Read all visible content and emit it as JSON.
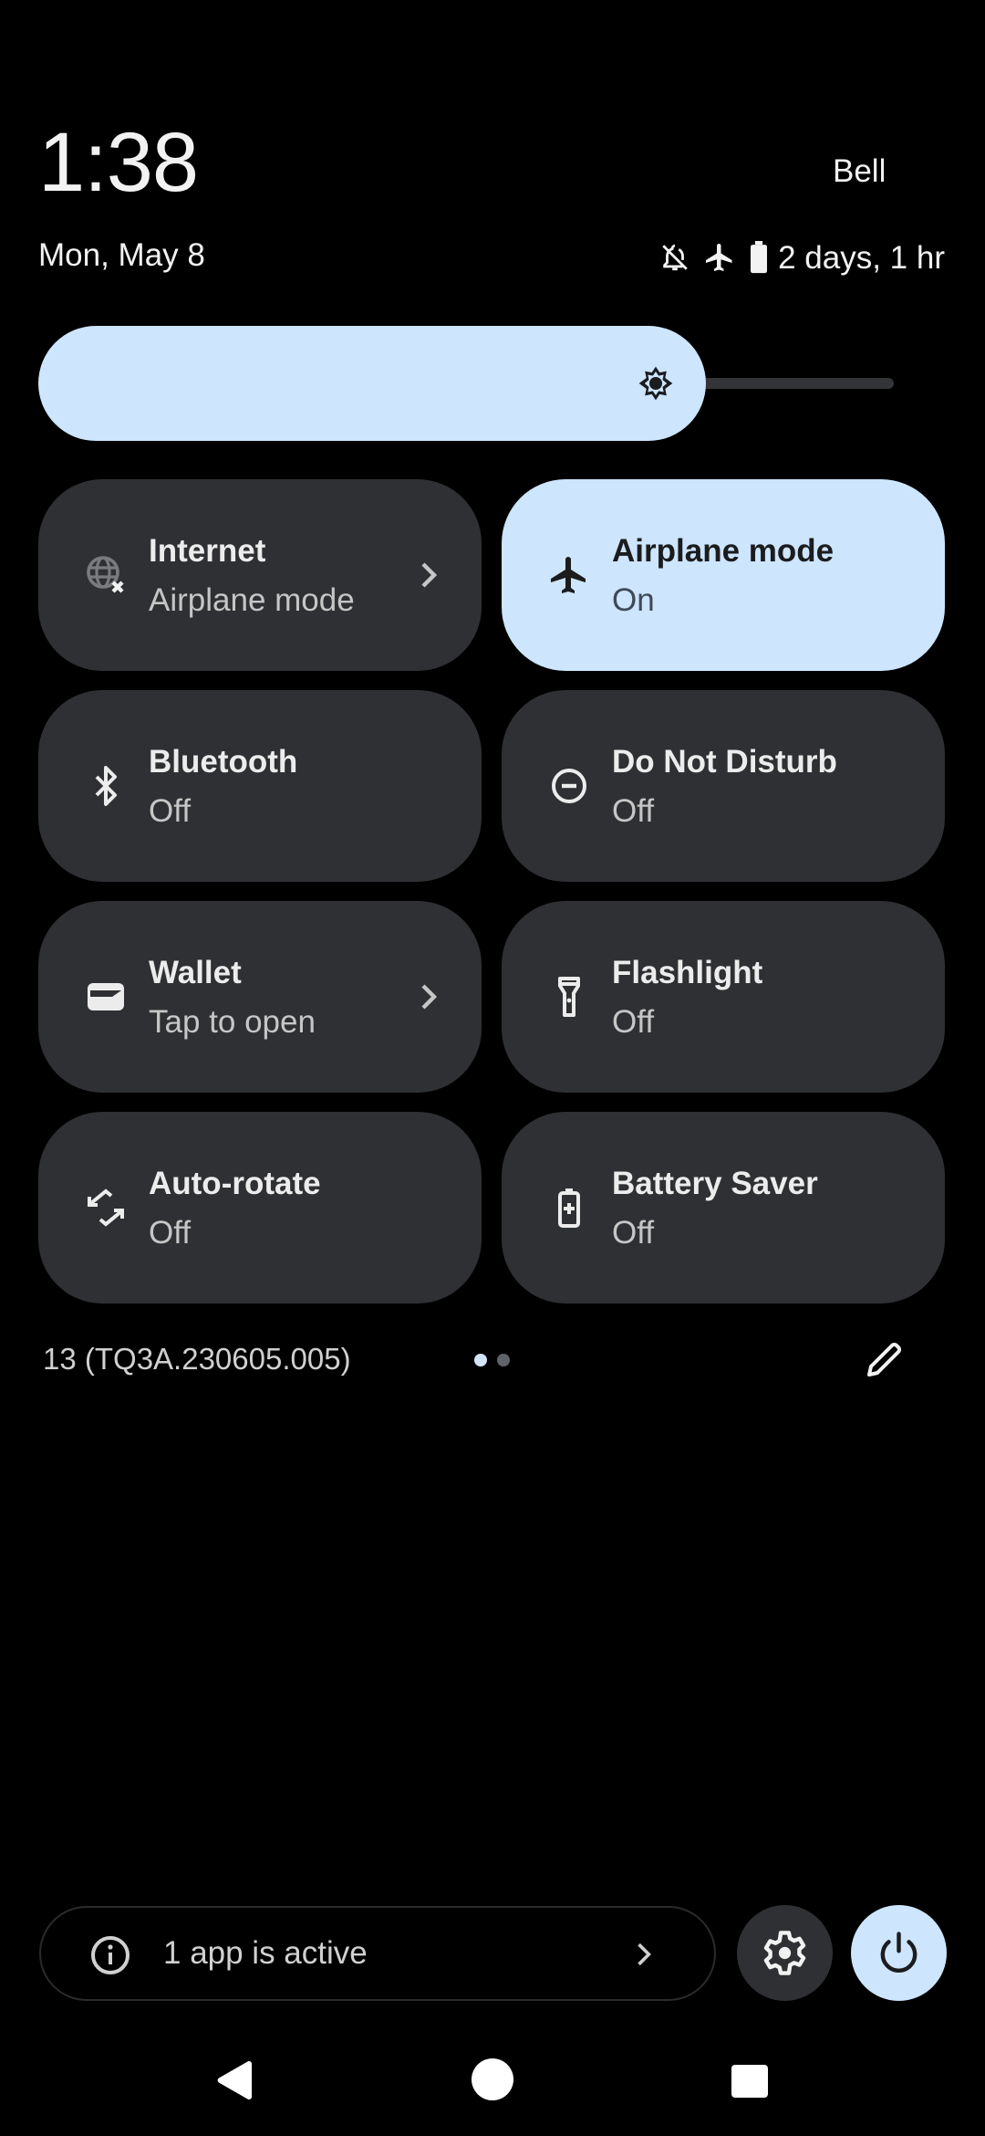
{
  "header": {
    "time": "1:38",
    "carrier": "Bell",
    "date": "Mon, May 8",
    "status_icons": [
      "dnd-off-bell-icon",
      "airplane-icon",
      "battery-icon"
    ],
    "battery_text": "2 days, 1 hr"
  },
  "brightness": {
    "icon": "brightness-icon",
    "level": 0.78
  },
  "tiles": [
    {
      "label": "Internet",
      "sub": "Airplane mode",
      "icon": "globe-off-icon",
      "state": "off",
      "has_chevron": true
    },
    {
      "label": "Airplane mode",
      "sub": "On",
      "icon": "airplane-icon",
      "state": "on",
      "has_chevron": false
    },
    {
      "label": "Bluetooth",
      "sub": "Off",
      "icon": "bluetooth-icon",
      "state": "off",
      "has_chevron": false
    },
    {
      "label": "Do Not Disturb",
      "sub": "Off",
      "icon": "do-not-disturb-icon",
      "state": "off",
      "has_chevron": false
    },
    {
      "label": "Wallet",
      "sub": "Tap to open",
      "icon": "wallet-icon",
      "state": "off",
      "has_chevron": true
    },
    {
      "label": "Flashlight",
      "sub": "Off",
      "icon": "flashlight-icon",
      "state": "off",
      "has_chevron": false
    },
    {
      "label": "Auto-rotate",
      "sub": "Off",
      "icon": "auto-rotate-icon",
      "state": "off",
      "has_chevron": false
    },
    {
      "label": "Battery Saver",
      "sub": "Off",
      "icon": "battery-saver-icon",
      "state": "off",
      "has_chevron": false
    }
  ],
  "build_number": "13 (TQ3A.230605.005)",
  "pager": {
    "pages": 2,
    "current": 1
  },
  "footer": {
    "active_apps_text": "1 app is active",
    "settings_icon": "gear-icon",
    "power_icon": "power-icon"
  },
  "nav": {
    "back": "back-icon",
    "home": "home-icon",
    "recents": "recents-icon"
  },
  "colors": {
    "accent": "#cde5fd",
    "tile_bg": "#2f3033",
    "background": "#000000",
    "dot_active": "#d3e3fd",
    "dot_inactive": "#5f6368"
  }
}
